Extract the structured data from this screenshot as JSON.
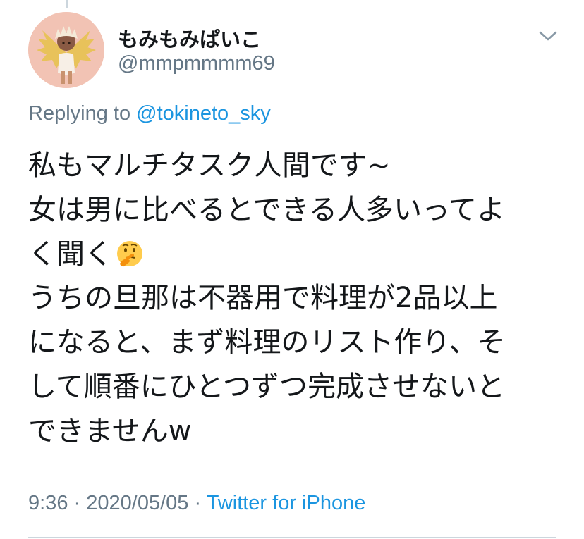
{
  "user": {
    "display_name": "もみもみぱいこ",
    "handle": "@mmpmmmm69"
  },
  "reply": {
    "prefix": "Replying to",
    "target": "@tokineto_sky"
  },
  "tweet": {
    "lines": [
      "私もマルチタスク人間です~",
      "女は男に比べるとできる人多いってよ",
      "く聞く",
      "うちの旦那は不器用で料理が2品以上",
      "になると、まず料理のリスト作り、そ",
      "して順番にひとつずつ完成させないと",
      "できませんw"
    ],
    "emoji": "thinking-face"
  },
  "meta": {
    "time": "9:36",
    "separator": "·",
    "date": "2020/05/05",
    "source": "Twitter for iPhone"
  },
  "colors": {
    "text": "#14171a",
    "secondary": "#657786",
    "link": "#1b95e0",
    "divider": "#ccd6dd",
    "avatar_bg": "#f2c3b4"
  }
}
